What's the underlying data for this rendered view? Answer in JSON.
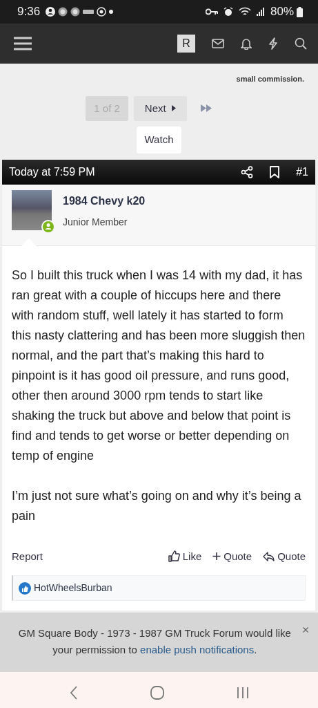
{
  "status_bar": {
    "time": "9:36",
    "battery": "80%"
  },
  "top_bar": {
    "avatar_letter": "R"
  },
  "disclosure": "small commission.",
  "pagination": {
    "page_label": "1 of 2",
    "next_label": "Next"
  },
  "watch_button": "Watch",
  "post": {
    "date": "Today at 7:59 PM",
    "number": "#1",
    "author": {
      "name": "1984 Chevy k20",
      "title": "Junior Member"
    },
    "paragraphs": [
      "So I built this truck when I was 14 with my dad, it has ran great with a couple of hiccups here and there with random stuff, well lately it has started to form this nasty clattering and has been more sluggish then normal, and the part that’s making this hard to pinpoint is it has good oil pressure, and runs good, other then around 3000 rpm tends to start like shaking the truck but above and below that point is find and tends to get worse or better depending on temp of engine",
      "I’m just not sure what’s going on and why it’s being a pain"
    ],
    "report": "Report",
    "actions": [
      {
        "kind": "like",
        "label": "Like"
      },
      {
        "kind": "multiquote",
        "label": "Quote"
      },
      {
        "kind": "reply",
        "label": "Quote"
      }
    ],
    "reactions": {
      "users": "HotWheelsBurban"
    }
  },
  "push_notice": {
    "text_before": "GM Square Body - 1973 - 1987 GM Truck Forum would like your permission to ",
    "link": "enable push notifications",
    "text_after": "."
  }
}
